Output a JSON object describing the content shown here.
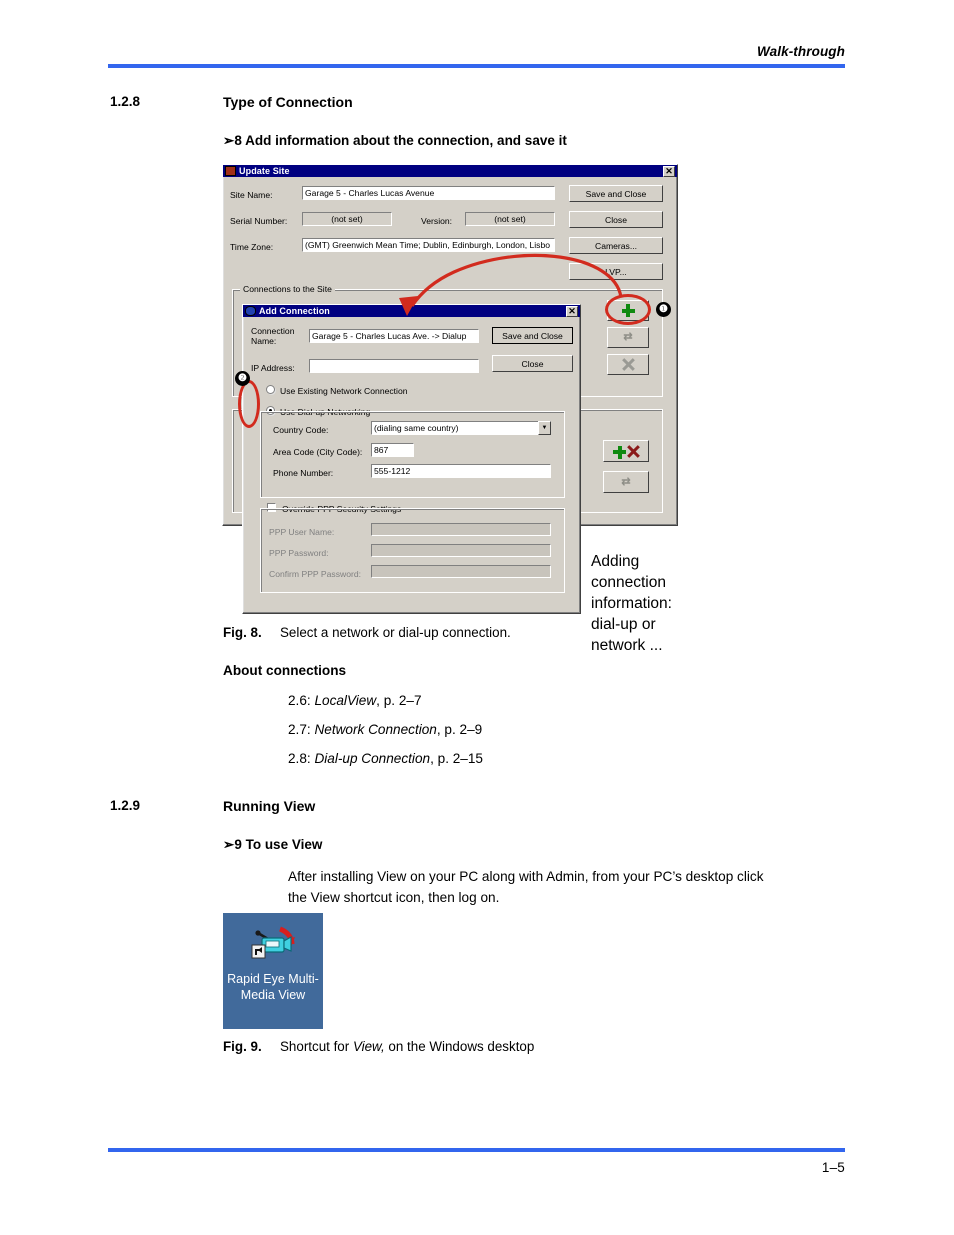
{
  "header": {
    "running_head": "Walk-through"
  },
  "footer": {
    "page_number": "1–5"
  },
  "sections": [
    {
      "number": "1.2.8",
      "title": "Type of Connection"
    },
    {
      "number": "1.2.9",
      "title": "Running View"
    }
  ],
  "procedures": [
    {
      "marker": "➢",
      "label": "8 Add information about the connection, and save it"
    },
    {
      "marker": "➢",
      "label": "9 To use View"
    }
  ],
  "figure8": {
    "caption_name": "Fig. 8.",
    "caption_text": "Select a network or dial-up connection.",
    "update_site": {
      "title": "Update Site",
      "close_glyph": "✕",
      "labels": {
        "site_name": "Site Name:",
        "serial_number": "Serial Number:",
        "version": "Version:",
        "time_zone": "Time Zone:",
        "connections_group": "Connections to the Site"
      },
      "values": {
        "site_name": "Garage 5 - Charles Lucas Avenue",
        "serial_number": "(not set)",
        "version": "(not set)",
        "time_zone": "(GMT) Greenwich Mean Time; Dublin, Edinburgh, London, Lisbo"
      },
      "buttons": {
        "save_and_close": "Save and Close",
        "close": "Close",
        "cameras": "Cameras...",
        "lvp": "LVP..."
      },
      "icon_buttons": [
        "add-connection-icon",
        "refresh-connection-icon",
        "delete-connection-icon",
        "add-delete-icon",
        "refresh-icon"
      ]
    },
    "add_connection": {
      "title": "Add Connection",
      "close_glyph": "✕",
      "labels": {
        "connection_name_line1": "Connection",
        "connection_name_line2": "Name:",
        "ip_address": "IP Address:",
        "use_existing_network": "Use Existing Network Connection",
        "use_dialup": "Use Dial-up Networking",
        "country_code": "Country Code:",
        "area_code": "Area Code (City Code):",
        "phone_number": "Phone Number:",
        "override_ppp": "Override PPP Security Settings",
        "ppp_user_name": "PPP User Name:",
        "ppp_password": "PPP Password:",
        "confirm_ppp_password": "Confirm PPP Password:"
      },
      "values": {
        "connection_name": "Garage 5 - Charles Lucas Ave. -> Dialup",
        "ip_address": "",
        "country_code": "(dialing same country)",
        "area_code": "867",
        "phone_number": "555-1212",
        "ppp_user_name": "",
        "ppp_password": "",
        "confirm_ppp_password": ""
      },
      "selected_radio": "use_dialup",
      "override_ppp_checked": false,
      "buttons": {
        "save_and_close": "Save and Close",
        "close": "Close"
      },
      "dropdown_arrow": "▼"
    },
    "annotations": {
      "callout_1": "❶",
      "callout_2": "❷",
      "handwritten_note": "Adding connection\ninformation:\ndial-up or network ..."
    }
  },
  "about_connections": {
    "heading": "About connections",
    "items": [
      {
        "num": "2.6: ",
        "title": "LocalView",
        "page": ", p. 2–7"
      },
      {
        "num": "2.7: ",
        "title": "Network Connection",
        "page": ", p. 2–9"
      },
      {
        "num": "2.8: ",
        "title": "Dial-up Connection",
        "page": ", p. 2–15"
      }
    ]
  },
  "running_view": {
    "body_line1": "After installing View on your PC along with Admin, from your PC’s desktop click",
    "body_line2": "the View shortcut icon, then log on."
  },
  "figure9": {
    "shortcut_label": "Rapid Eye\nMulti-Media\nView",
    "caption_name": "Fig. 9.",
    "caption_before": "Shortcut for ",
    "caption_italic": "View,",
    "caption_after": " on the Windows desktop"
  },
  "colors": {
    "rule_blue": "#3366EE",
    "annotation_red": "#D22B1E",
    "desktop_blue": "#416A9B",
    "titlebar_blue": "#000080",
    "dialog_face": "#d4d0c8",
    "icon_green": "#108A10",
    "icon_dark_red": "#8B1A1A"
  }
}
